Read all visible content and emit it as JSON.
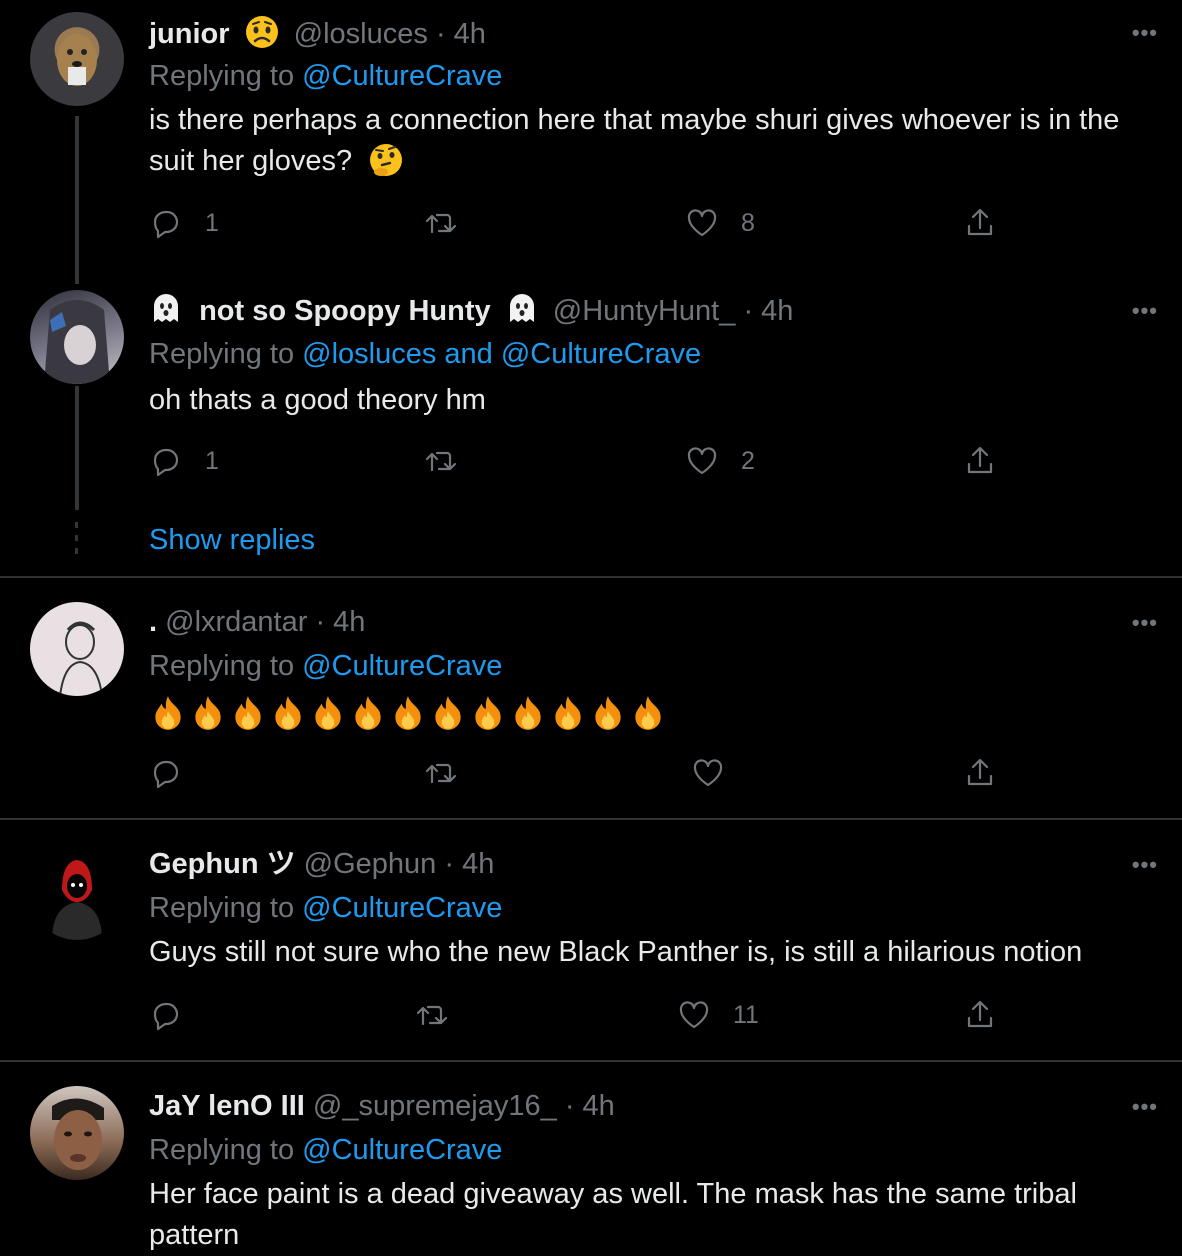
{
  "tweets": [
    {
      "name": "junior",
      "handle": "@losluces",
      "time": "· 4h",
      "replying_prefix": "Replying to",
      "replying_to": "@CultureCrave",
      "text_line1": "is there perhaps a connection here that maybe shuri gives whoever is in the",
      "text_line2": "suit her gloves?",
      "replies": "1",
      "retweets": "",
      "likes": "8"
    },
    {
      "name": "not so Spoopy Hunty",
      "handle": "@HuntyHunt_",
      "time": "· 4h",
      "replying_prefix": "Replying to",
      "replying_to": "@losluces and @CultureCrave",
      "text": "oh thats a good theory hm",
      "replies": "1",
      "retweets": "",
      "likes": "2"
    },
    {
      "name": ".",
      "handle": "@lxrdantar",
      "time": "· 4h",
      "replying_prefix": "Replying to",
      "replying_to": "@CultureCrave",
      "fire_count": 13,
      "replies": "",
      "retweets": "",
      "likes": ""
    },
    {
      "name": "Gephun ツ",
      "handle": "@Gephun",
      "time": "· 4h",
      "replying_prefix": "Replying to",
      "replying_to": "@CultureCrave",
      "text": "Guys still not sure who the new Black Panther is, is still a hilarious notion",
      "replies": "",
      "retweets": "",
      "likes": "11"
    },
    {
      "name": "JaY lenO III",
      "handle": "@_supremejay16_",
      "time": "· 4h",
      "replying_prefix": "Replying to",
      "replying_to": "@CultureCrave",
      "text_line1": "Her face paint is a dead giveaway as well. The mask has the same tribal",
      "text_line2": "pattern"
    }
  ],
  "show_replies": "Show replies",
  "more_label": "•••",
  "colors": {
    "accent": "#1d9bf0",
    "muted": "#71767b",
    "background": "#000000"
  },
  "icons": [
    "reply-icon",
    "retweet-icon",
    "like-icon",
    "share-icon",
    "more-icon",
    "ghost-emoji",
    "fire-emoji",
    "thinking-emoji",
    "worried-emoji"
  ]
}
